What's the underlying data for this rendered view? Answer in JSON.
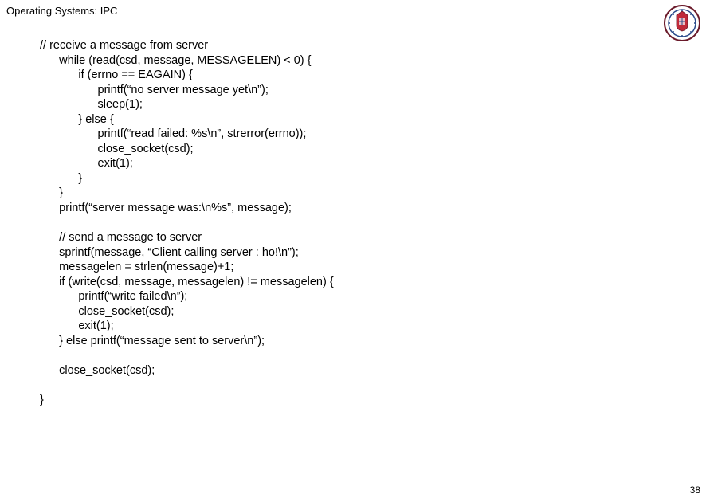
{
  "header": {
    "title": "Operating Systems: IPC"
  },
  "code": {
    "lines": [
      "// receive a message from server",
      "      while (read(csd, message, MESSAGELEN) < 0) {",
      "            if (errno == EAGAIN) {",
      "                  printf(“no server message yet\\n”);",
      "                  sleep(1);",
      "            } else {",
      "                  printf(“read failed: %s\\n”, strerror(errno));",
      "                  close_socket(csd);",
      "                  exit(1);",
      "            }",
      "      }",
      "      printf(“server message was:\\n%s”, message);",
      "",
      "      // send a message to server",
      "      sprintf(message, “Client calling server : ho!\\n”);",
      "      messagelen = strlen(message)+1;",
      "      if (write(csd, message, messagelen) != messagelen) {",
      "            printf(“write failed\\n”);",
      "            close_socket(csd);",
      "            exit(1);",
      "      } else printf(“message sent to server\\n”);",
      "",
      "      close_socket(csd);",
      "",
      "}"
    ]
  },
  "footer": {
    "page_number": "38"
  },
  "crest": {
    "label": "university-crest"
  }
}
